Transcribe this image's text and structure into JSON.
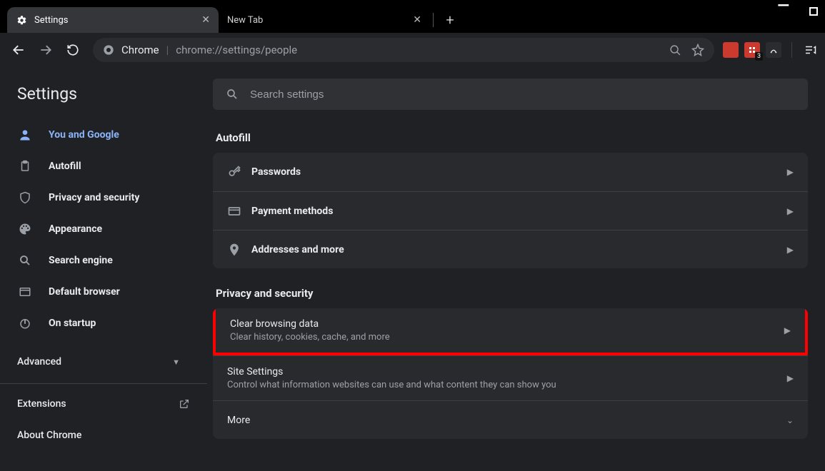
{
  "window": {
    "tabs": [
      {
        "title": "Settings",
        "active": true
      },
      {
        "title": "New Tab",
        "active": false
      }
    ]
  },
  "toolbar": {
    "omnibox_chip": "Chrome",
    "omnibox_url": "chrome://settings/people"
  },
  "sidebar": {
    "title": "Settings",
    "items": [
      {
        "id": "you-and-google",
        "label": "You and Google",
        "active": true
      },
      {
        "id": "autofill",
        "label": "Autofill"
      },
      {
        "id": "privacy",
        "label": "Privacy and security"
      },
      {
        "id": "appearance",
        "label": "Appearance"
      },
      {
        "id": "search-engine",
        "label": "Search engine"
      },
      {
        "id": "default-browser",
        "label": "Default browser"
      },
      {
        "id": "on-startup",
        "label": "On startup"
      }
    ],
    "advanced": "Advanced",
    "footer": [
      {
        "id": "extensions",
        "label": "Extensions",
        "external": true
      },
      {
        "id": "about",
        "label": "About Chrome"
      }
    ]
  },
  "search": {
    "placeholder": "Search settings"
  },
  "sections": {
    "autofill": {
      "title": "Autofill",
      "rows": [
        {
          "id": "passwords",
          "title": "Passwords"
        },
        {
          "id": "payment",
          "title": "Payment methods"
        },
        {
          "id": "addresses",
          "title": "Addresses and more"
        }
      ]
    },
    "privacy": {
      "title": "Privacy and security",
      "rows": [
        {
          "id": "clear-data",
          "title": "Clear browsing data",
          "sub": "Clear history, cookies, cache, and more",
          "highlight": true
        },
        {
          "id": "site-settings",
          "title": "Site Settings",
          "sub": "Control what information websites can use and what content they can show you"
        },
        {
          "id": "more",
          "title": "More",
          "chevron": "down"
        }
      ]
    }
  },
  "ext_badge": "3"
}
